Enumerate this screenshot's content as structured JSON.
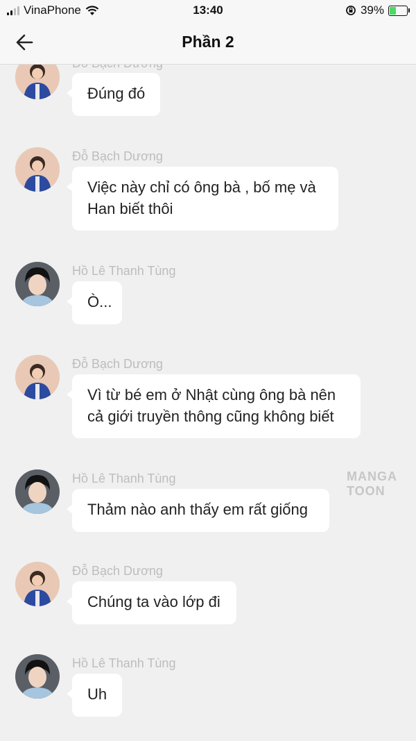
{
  "status_bar": {
    "carrier": "VinaPhone",
    "time": "13:40",
    "battery": "39%",
    "battery_level": 0.39
  },
  "header": {
    "title": "Phần 2"
  },
  "messages": [
    {
      "sender": "Đỗ Bạch Dương",
      "text": "Đúng đó"
    },
    {
      "sender": "Đỗ Bạch Dương",
      "text": "Việc này chỉ có ông bà , bố mẹ và Han biết thôi"
    },
    {
      "sender": "Hồ Lê Thanh Tùng",
      "text": "Ò..."
    },
    {
      "sender": "Đỗ Bạch Dương",
      "text": "Vì từ bé em ở Nhật cùng ông bà nên cả giới truyền thông cũng không biết"
    },
    {
      "sender": "Hồ Lê Thanh Tùng",
      "text": "Thảm nào anh thấy em rất giống"
    },
    {
      "sender": "Đỗ Bạch Dương",
      "text": "Chúng ta vào lớp đi"
    },
    {
      "sender": "Hồ Lê Thanh Tùng",
      "text": "Uh"
    }
  ],
  "watermark": "MANGA TOON",
  "colors": {
    "bubble": "#ffffff",
    "background": "#f0f0f0",
    "battery": "#4cd964"
  }
}
